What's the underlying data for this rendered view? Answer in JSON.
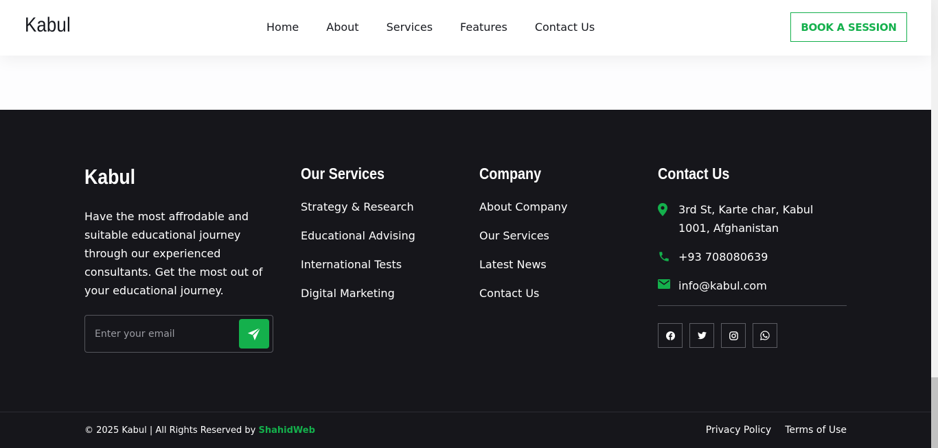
{
  "header": {
    "logo": "Kabul",
    "nav": [
      {
        "label": "Home"
      },
      {
        "label": "About"
      },
      {
        "label": "Services"
      },
      {
        "label": "Features"
      },
      {
        "label": "Contact Us"
      }
    ],
    "cta_label": "BOOK A SESSION"
  },
  "footer": {
    "brand": {
      "title": "Kabul",
      "description": "Have the most affrodable and suitable educational journey through our experienced consultants. Get the most out of your educational journey.",
      "email_placeholder": "Enter your email",
      "send_icon": "paper-plane-icon"
    },
    "services": {
      "title": "Our Services",
      "links": [
        "Strategy & Research",
        "Educational Advising",
        "International Tests",
        "Digital Marketing"
      ]
    },
    "company": {
      "title": "Company",
      "links": [
        "About Company",
        "Our Services",
        "Latest News",
        "Contact Us"
      ]
    },
    "contact": {
      "title": "Contact Us",
      "address": "3rd St, Karte char, Kabul 1001, Afghanistan",
      "phone": "+93 708080639",
      "email": "info@kabul.com",
      "socials": [
        "facebook-icon",
        "twitter-icon",
        "instagram-icon",
        "whatsapp-icon"
      ]
    },
    "bottom": {
      "copyright_prefix": "© 2025 Kabul | All Rights Reserved by ",
      "credit": "ShahidWeb",
      "legal": [
        "Privacy Policy",
        "Terms of Use"
      ]
    }
  },
  "colors": {
    "accent": "#14b04c",
    "footer_bg": "#16161b",
    "text_dark": "#16181e"
  }
}
